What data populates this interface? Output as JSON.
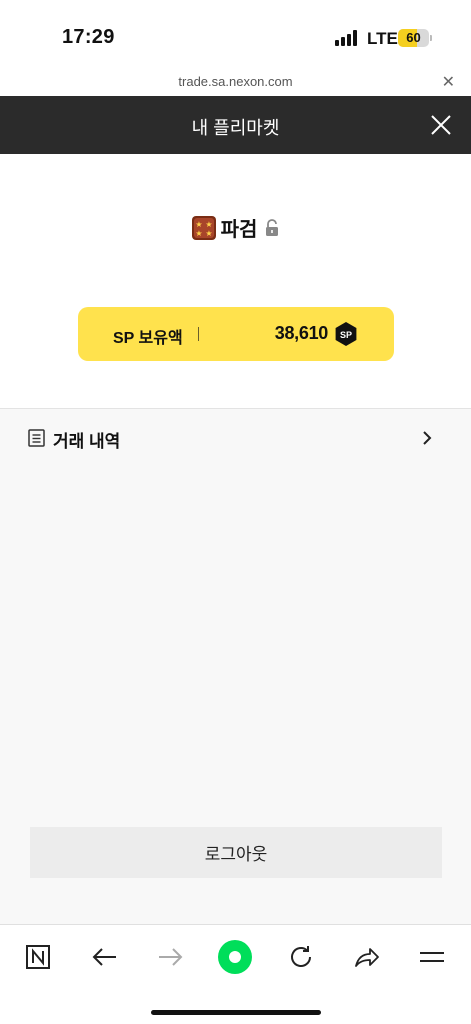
{
  "status_bar": {
    "time": "17:29",
    "network": "LTE",
    "battery": "60",
    "battery_level": 0.6
  },
  "browser": {
    "url": "trade.sa.nexon.com",
    "close_icon": "close-icon"
  },
  "header": {
    "title": "내 플리마켓",
    "close_icon": "close-icon"
  },
  "profile": {
    "name": "파검",
    "rank_icon": "rank-icon",
    "lock_icon": "lock-icon"
  },
  "sp_card": {
    "label": "SP 보유액",
    "amount": "38,610",
    "badge": "SP"
  },
  "history": {
    "label": "거래 내역",
    "icon": "document-icon",
    "chevron": "chevron-right-icon"
  },
  "logout": {
    "label": "로그아웃"
  },
  "toolbar": {
    "items": [
      "naver-icon",
      "back-icon",
      "forward-icon",
      "green-dot-icon",
      "refresh-icon",
      "share-icon",
      "menu-icon"
    ]
  },
  "colors": {
    "header_bg": "#2b2b2b",
    "sp_card_bg": "#ffe24d",
    "accent_green": "#00de5a",
    "battery": "#f5cf1f"
  }
}
